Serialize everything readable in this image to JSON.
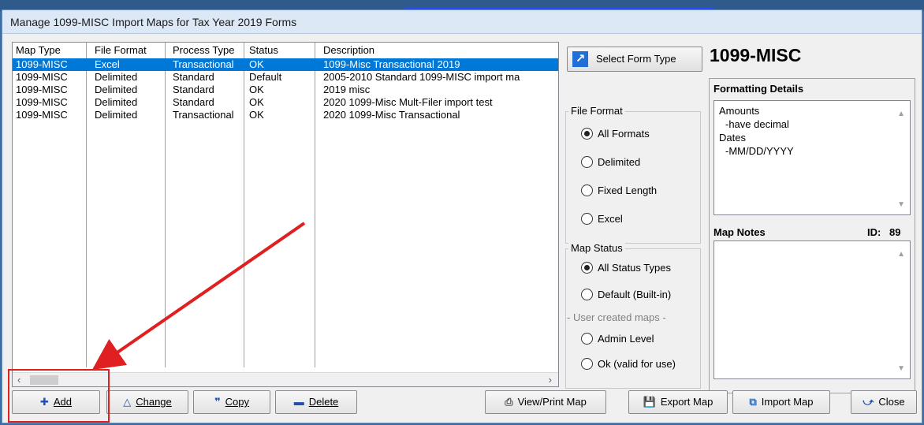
{
  "window": {
    "title": "Manage 1099-MISC Import Maps for Tax Year 2019 Forms"
  },
  "list": {
    "columns": [
      "Map Type",
      "File Format",
      "Process Type",
      "Status",
      "Description"
    ],
    "rows": [
      {
        "map_type": "1099-MISC",
        "file_format": "Excel",
        "process_type": "Transactional",
        "status": "OK",
        "description": "1099-Misc Transactional 2019",
        "selected": true
      },
      {
        "map_type": "1099-MISC",
        "file_format": "Delimited",
        "process_type": "Standard",
        "status": "Default",
        "description": "2005-2010 Standard 1099-MISC import ma"
      },
      {
        "map_type": "1099-MISC",
        "file_format": "Delimited",
        "process_type": "Standard",
        "status": "OK",
        "description": "2019 misc"
      },
      {
        "map_type": "1099-MISC",
        "file_format": "Delimited",
        "process_type": "Standard",
        "status": "OK",
        "description": "2020 1099-Misc Mult-Filer import test"
      },
      {
        "map_type": "1099-MISC",
        "file_format": "Delimited",
        "process_type": "Transactional",
        "status": "OK",
        "description": "2020 1099-Misc Transactional"
      }
    ]
  },
  "select_form_type_label": "Select Form Type",
  "form_type": "1099-MISC",
  "file_format": {
    "label": "File Format",
    "options": [
      "All Formats",
      "Delimited",
      "Fixed Length",
      "Excel"
    ],
    "selected": "All Formats"
  },
  "map_status": {
    "label": "Map Status",
    "options": [
      "All Status Types",
      "Default (Built-in)",
      "Admin Level",
      "Ok (valid for use)"
    ],
    "user_created_label": "- User created maps -",
    "selected": "All Status Types"
  },
  "formatting_details": {
    "label": "Formatting Details",
    "lines": [
      "Amounts",
      "-have decimal",
      "Dates",
      "-MM/DD/YYYY"
    ]
  },
  "map_notes": {
    "label": "Map Notes",
    "id_label": "ID:",
    "id_value": "89"
  },
  "buttons": {
    "add": "Add",
    "change": "Change",
    "copy": "Copy",
    "delete": "Delete",
    "view_print": "View/Print Map",
    "export": "Export Map",
    "import": "Import Map",
    "close": "Close"
  },
  "colors": {
    "selection": "#0078d7",
    "annotation": "#e02020",
    "icon_blue": "#1f6fd8"
  }
}
